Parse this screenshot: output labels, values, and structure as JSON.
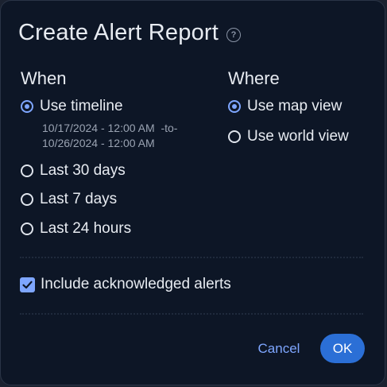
{
  "dialog": {
    "title": "Create Alert Report",
    "help_icon": "question-circle-icon",
    "help_glyph": "?"
  },
  "when": {
    "label": "When",
    "options": [
      {
        "label": "Use timeline",
        "checked": true
      },
      {
        "label": "Last 30 days",
        "checked": false
      },
      {
        "label": "Last 7 days",
        "checked": false
      },
      {
        "label": "Last 24 hours",
        "checked": false
      }
    ],
    "timeline_range": {
      "start": "10/17/2024 - 12:00 AM",
      "separator": "-to-",
      "end": "10/26/2024 - 12:00 AM"
    }
  },
  "where": {
    "label": "Where",
    "options": [
      {
        "label": "Use map view",
        "checked": true
      },
      {
        "label": "Use world view",
        "checked": false
      }
    ]
  },
  "include_acknowledged": {
    "label": "Include acknowledged alerts",
    "checked": true
  },
  "buttons": {
    "cancel": "Cancel",
    "ok": "OK"
  },
  "colors": {
    "background": "#0d1626",
    "accent": "#7ea6ff",
    "primary_button": "#2b6fd6",
    "text": "#e7ebf1",
    "muted_text": "#9aa3b2"
  }
}
